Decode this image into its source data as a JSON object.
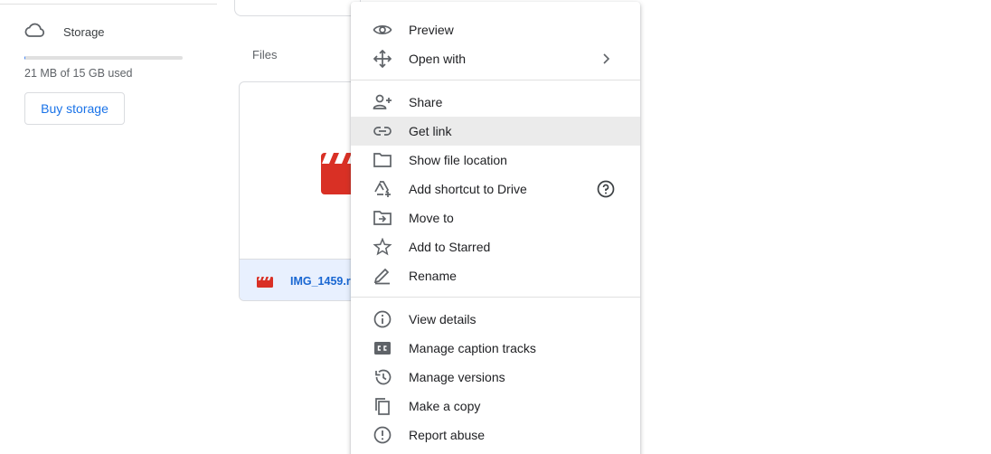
{
  "sidebar": {
    "storage_label": "Storage",
    "storage_used_text": "21 MB of 15 GB used",
    "storage_used_fraction": 0.0014,
    "buy_storage_label": "Buy storage"
  },
  "main": {
    "files_heading": "Files",
    "file": {
      "name": "IMG_1459.r",
      "icon": "video-file-icon"
    }
  },
  "context_menu": {
    "groups": [
      [
        {
          "label": "Preview",
          "icon": "eye-icon"
        },
        {
          "label": "Open with",
          "icon": "move-arrows-icon",
          "trailing": "chevron-right-icon"
        }
      ],
      [
        {
          "label": "Share",
          "icon": "add-person-icon"
        },
        {
          "label": "Get link",
          "icon": "link-icon",
          "highlighted": true
        },
        {
          "label": "Show file location",
          "icon": "folder-icon"
        },
        {
          "label": "Add shortcut to Drive",
          "icon": "drive-shortcut-icon",
          "trailing": "help-icon"
        },
        {
          "label": "Move to",
          "icon": "move-to-folder-icon"
        },
        {
          "label": "Add to Starred",
          "icon": "star-icon"
        },
        {
          "label": "Rename",
          "icon": "pencil-icon"
        }
      ],
      [
        {
          "label": "View details",
          "icon": "info-icon"
        },
        {
          "label": "Manage caption tracks",
          "icon": "closed-caption-icon"
        },
        {
          "label": "Manage versions",
          "icon": "history-icon"
        },
        {
          "label": "Make a copy",
          "icon": "copy-icon"
        },
        {
          "label": "Report abuse",
          "icon": "report-icon"
        }
      ]
    ]
  },
  "colors": {
    "accent": "#1a73e8",
    "file_red": "#d93025",
    "highlight": "#ebebeb",
    "selected_footer": "#e8f0fe"
  }
}
